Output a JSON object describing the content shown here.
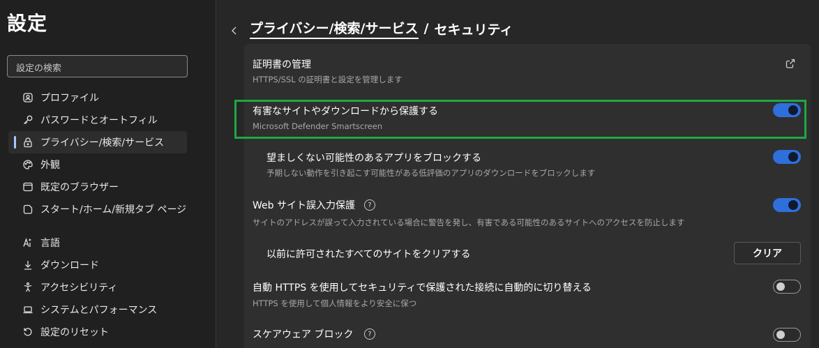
{
  "sidebar": {
    "title": "設定",
    "search_placeholder": "設定の検索",
    "items": [
      {
        "label": "プロファイル",
        "icon": "profile-icon"
      },
      {
        "label": "パスワードとオートフィル",
        "icon": "key-icon"
      },
      {
        "label": "プライバシー/検索/サービス",
        "icon": "lock-icon",
        "active": true
      },
      {
        "label": "外観",
        "icon": "palette-icon"
      },
      {
        "label": "既定のブラウザー",
        "icon": "browser-icon"
      },
      {
        "label": "スタート/ホーム/新規タブ ページ",
        "icon": "home-page-icon"
      },
      {
        "label": "言語",
        "icon": "language-icon"
      },
      {
        "label": "ダウンロード",
        "icon": "download-icon"
      },
      {
        "label": "アクセシビリティ",
        "icon": "accessibility-icon"
      },
      {
        "label": "システムとパフォーマンス",
        "icon": "laptop-icon"
      },
      {
        "label": "設定のリセット",
        "icon": "reset-icon"
      }
    ]
  },
  "breadcrumb": {
    "parent": "プライバシー/検索/サービス",
    "separator": "/",
    "current": "セキュリティ"
  },
  "settings": {
    "cert": {
      "title": "証明書の管理",
      "desc": "HTTPS/SSL の証明書と設定を管理します"
    },
    "smartscreen": {
      "title": "有害なサイトやダウンロードから保護する",
      "desc": "Microsoft Defender Smartscreen",
      "enabled": true
    },
    "pua": {
      "title": "望ましくない可能性のあるアプリをブロックする",
      "desc": "予期しない動作を引き起こす可能性がある低評価のアプリのダウンロードをブロックします",
      "enabled": true
    },
    "typo": {
      "title": "Web サイト誤入力保護",
      "help": "?",
      "desc": "サイトのアドレスが誤って入力されている場合に警告を発し、有害である可能性のあるサイトへのアクセスを防止します",
      "enabled": true
    },
    "clear_sites": {
      "title": "以前に許可されたすべてのサイトをクリアする",
      "button": "クリア"
    },
    "auto_https": {
      "title": "自動 HTTPS を使用してセキュリティで保護された接続に自動的に切り替える",
      "desc": "HTTPS を使用して個人情報をより安全に保つ",
      "enabled": false
    },
    "scareware": {
      "title": "スケアウェア ブロック",
      "help": "?",
      "enabled": false
    }
  },
  "colors": {
    "accent": "#2f6fdc",
    "highlight": "#1ea843",
    "background": "#272727",
    "card": "#2f2f2f"
  }
}
